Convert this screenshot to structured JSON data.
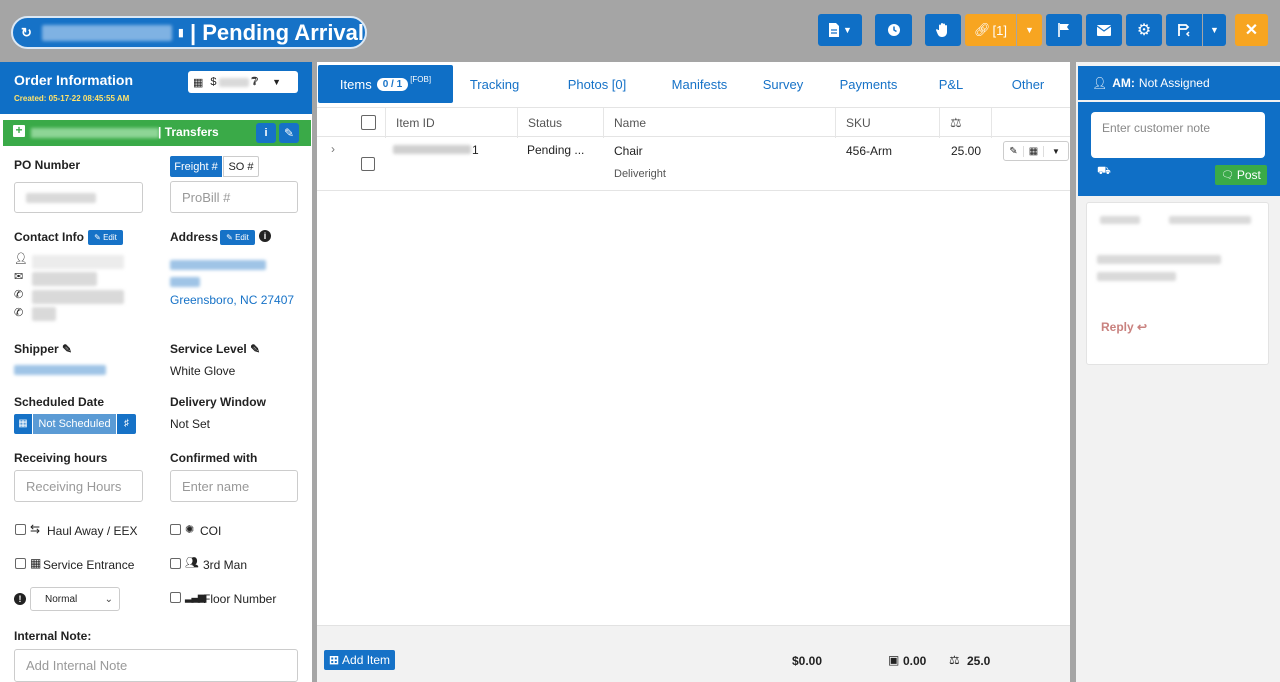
{
  "header": {
    "title": "| Pending Arrival",
    "link_label": "[1]"
  },
  "order": {
    "title": "Order Information",
    "created": "Created: 05-17-22 08:45:55 AM",
    "amount_prefix": "$",
    "transfers_label": "| Transfers",
    "po_label": "PO Number",
    "freight_tab": "Freight #",
    "so_tab": "SO #",
    "probill_placeholder": "ProBill #",
    "contact_label": "Contact Info",
    "edit_label": "Edit",
    "address_label": "Address",
    "address_city": "Greensboro, NC 27407",
    "shipper_label": "Shipper",
    "service_level_label": "Service Level",
    "service_level_value": "White Glove",
    "scheduled_label": "Scheduled Date",
    "not_scheduled": "Not Scheduled",
    "delivery_window_label": "Delivery Window",
    "delivery_window_value": "Not Set",
    "receiving_label": "Receiving hours",
    "receiving_placeholder": "Receiving Hours",
    "confirmed_label": "Confirmed with",
    "confirmed_placeholder": "Enter name",
    "haul_away": "Haul Away / EEX",
    "coi": "COI",
    "service_entrance": "Service Entrance",
    "third_man": "3rd Man",
    "priority_value": "Normal",
    "floor_number": "Floor Number",
    "internal_note_label": "Internal Note:",
    "internal_note_placeholder": "Add Internal Note"
  },
  "tabs": {
    "items": "Items",
    "items_badge": "0 / 1",
    "items_sup": "[FOB]",
    "tracking": "Tracking",
    "photos": "Photos [0]",
    "manifests": "Manifests",
    "survey": "Survey",
    "payments": "Payments",
    "pl": "P&L",
    "other": "Other"
  },
  "grid": {
    "columns": [
      "Item ID",
      "Status",
      "Name",
      "SKU"
    ],
    "rows": [
      {
        "id_suffix": "1",
        "status": "Pending ...",
        "name": "Chair",
        "sub": "Deliveright",
        "sku": "456-Arm",
        "weight": "25.00"
      }
    ]
  },
  "footer": {
    "add_item": "Add Item",
    "total_amount": "$0.00",
    "total_volume": "0.00",
    "total_weight": "25.0"
  },
  "right_panel": {
    "am_label": "AM:",
    "am_value": "Not Assigned",
    "note_placeholder": "Enter customer note",
    "post_label": "Post",
    "reply_label": "Reply"
  }
}
